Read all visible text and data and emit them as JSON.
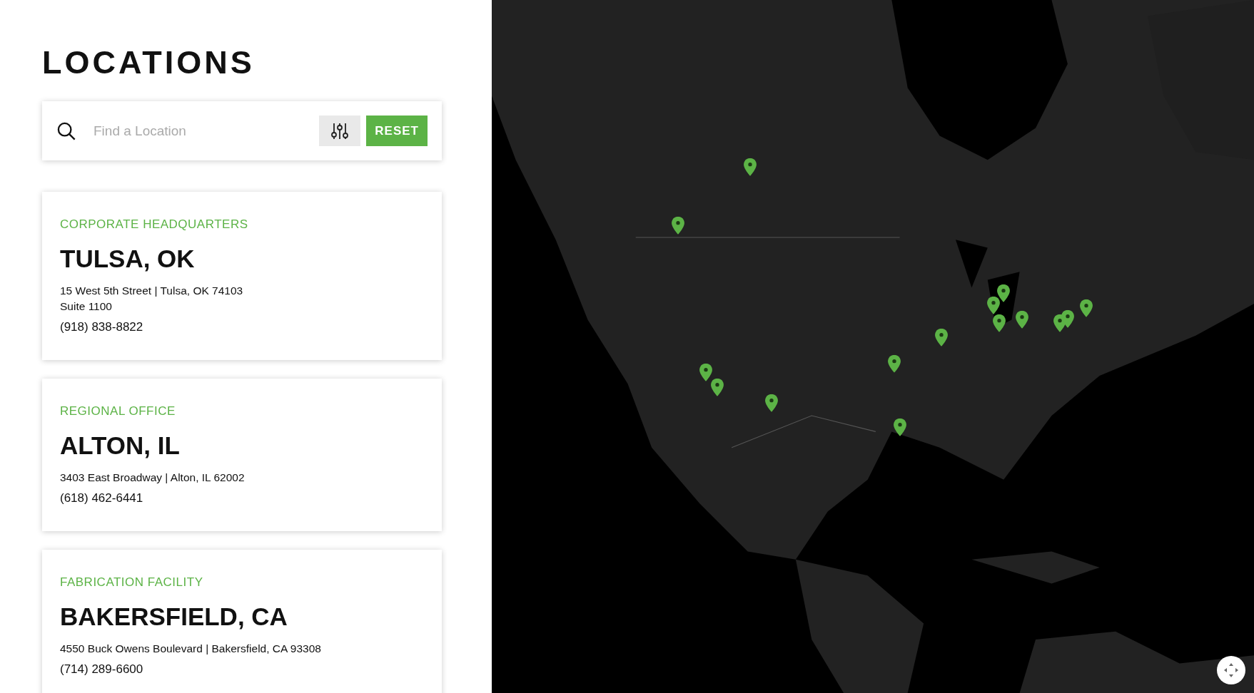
{
  "title": "LOCATIONS",
  "search": {
    "placeholder": "Find a Location",
    "reset": "RESET"
  },
  "locations": [
    {
      "category": "CORPORATE HEADQUARTERS",
      "city": "TULSA, OK",
      "address": "15 West 5th Street | Tulsa, OK 74103",
      "address2": "Suite 1100",
      "phone": "(918) 838-8822"
    },
    {
      "category": "REGIONAL OFFICE",
      "city": "ALTON, IL",
      "address": "3403 East Broadway | Alton, IL 62002",
      "phone": "(618) 462-6441"
    },
    {
      "category": "FABRICATION FACILITY",
      "city": "BAKERSFIELD, CA",
      "address": "4550 Buck Owens Boulevard | Bakersfield, CA 93308",
      "phone": "(714) 289-6600"
    }
  ]
}
